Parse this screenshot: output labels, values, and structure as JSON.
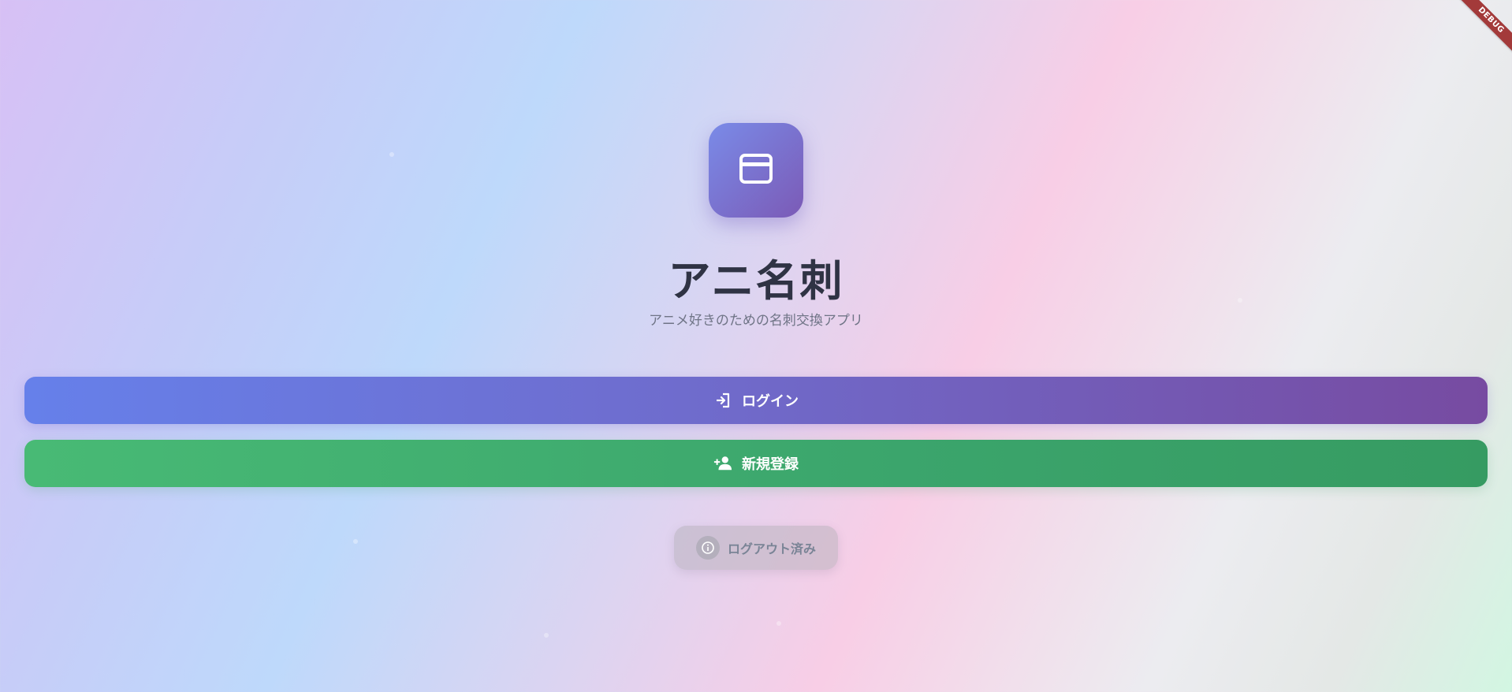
{
  "debug_banner": "DEBUG",
  "app": {
    "icon": "credit-card-icon",
    "title": "アニ名刺",
    "subtitle": "アニメ好きのための名刺交換アプリ"
  },
  "actions": {
    "login": {
      "label": "ログイン",
      "icon": "login-icon",
      "color_start": "#6680ea",
      "color_end": "#774ba1"
    },
    "register": {
      "label": "新規登録",
      "icon": "person-add-icon",
      "color_start": "#48ba75",
      "color_end": "#369b62"
    }
  },
  "status": {
    "label": "ログアウト済み",
    "icon": "info-icon"
  }
}
